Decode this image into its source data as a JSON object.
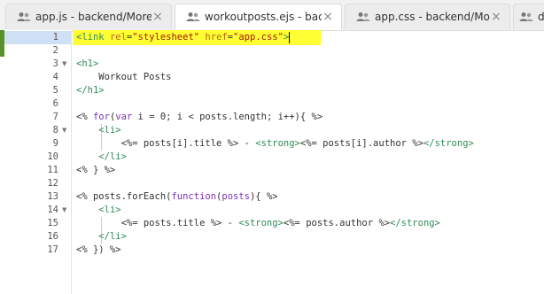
{
  "tabs": [
    {
      "label": "app.js - backend/MoreEx...",
      "icon": "users-icon",
      "close": "×",
      "active": false
    },
    {
      "label": "workoutposts.ejs - backe...",
      "icon": "users-icon",
      "close": "×",
      "active": true
    },
    {
      "label": "app.css - backend/MoreE...",
      "icon": "users-icon",
      "close": "×",
      "active": false
    },
    {
      "label": "die",
      "icon": "users-icon",
      "close": "",
      "active": false
    }
  ],
  "editor": {
    "line_numbers": [
      "1",
      "2",
      "3",
      "4",
      "5",
      "6",
      "7",
      "8",
      "9",
      "10",
      "11",
      "12",
      "13",
      "14",
      "15",
      "16",
      "17"
    ],
    "fold_markers": {
      "3": "▼",
      "8": "▼",
      "14": "▼"
    },
    "lines": [
      [
        {
          "c": "t-tag",
          "t": "<link "
        },
        {
          "c": "t-attr",
          "t": "rel"
        },
        {
          "c": "t-txt",
          "t": "="
        },
        {
          "c": "t-str",
          "t": "\"stylesheet\""
        },
        {
          "c": "t-txt",
          "t": " "
        },
        {
          "c": "t-attr",
          "t": "href"
        },
        {
          "c": "t-txt",
          "t": "="
        },
        {
          "c": "t-str",
          "t": "\"app.css\""
        },
        {
          "c": "t-tag",
          "t": ">"
        }
      ],
      [],
      [
        {
          "c": "t-tag",
          "t": "<h1>"
        }
      ],
      [
        {
          "c": "t-txt",
          "t": "    Workout Posts"
        }
      ],
      [
        {
          "c": "t-tag",
          "t": "</h1>"
        }
      ],
      [],
      [
        {
          "c": "t-txt",
          "t": "<% "
        },
        {
          "c": "t-kw",
          "t": "for"
        },
        {
          "c": "t-txt",
          "t": "("
        },
        {
          "c": "t-kw",
          "t": "var"
        },
        {
          "c": "t-txt",
          "t": " i = 0; i < posts.length; i++){ %>"
        }
      ],
      [
        {
          "c": "t-txt",
          "t": "    "
        },
        {
          "c": "t-tag",
          "t": "<li>"
        }
      ],
      [
        {
          "c": "t-txt",
          "t": "        <%= posts[i].title %> - "
        },
        {
          "c": "t-tag",
          "t": "<strong>"
        },
        {
          "c": "t-txt",
          "t": "<%= posts[i].author %>"
        },
        {
          "c": "t-tag",
          "t": "</strong>"
        }
      ],
      [
        {
          "c": "t-txt",
          "t": "    "
        },
        {
          "c": "t-tag",
          "t": "</li>"
        }
      ],
      [
        {
          "c": "t-txt",
          "t": "<% } %>"
        }
      ],
      [],
      [
        {
          "c": "t-txt",
          "t": "<% posts.forEach("
        },
        {
          "c": "t-kw",
          "t": "function"
        },
        {
          "c": "t-txt",
          "t": "("
        },
        {
          "c": "t-kw",
          "t": "posts"
        },
        {
          "c": "t-txt",
          "t": "){ %>"
        }
      ],
      [
        {
          "c": "t-txt",
          "t": "    "
        },
        {
          "c": "t-tag",
          "t": "<li>"
        }
      ],
      [
        {
          "c": "t-txt",
          "t": "        <%= posts.title %> - "
        },
        {
          "c": "t-tag",
          "t": "<strong>"
        },
        {
          "c": "t-txt",
          "t": "<%= posts.author %>"
        },
        {
          "c": "t-tag",
          "t": "</strong>"
        }
      ],
      [
        {
          "c": "t-txt",
          "t": "    "
        },
        {
          "c": "t-tag",
          "t": "</li>"
        }
      ],
      [
        {
          "c": "t-txt",
          "t": "<% }) %>"
        }
      ]
    ]
  },
  "colors": {
    "selection": "#ffff33",
    "active_line_number_bg": "#cfe0f5",
    "modified_bar": "#5a8f2e"
  }
}
